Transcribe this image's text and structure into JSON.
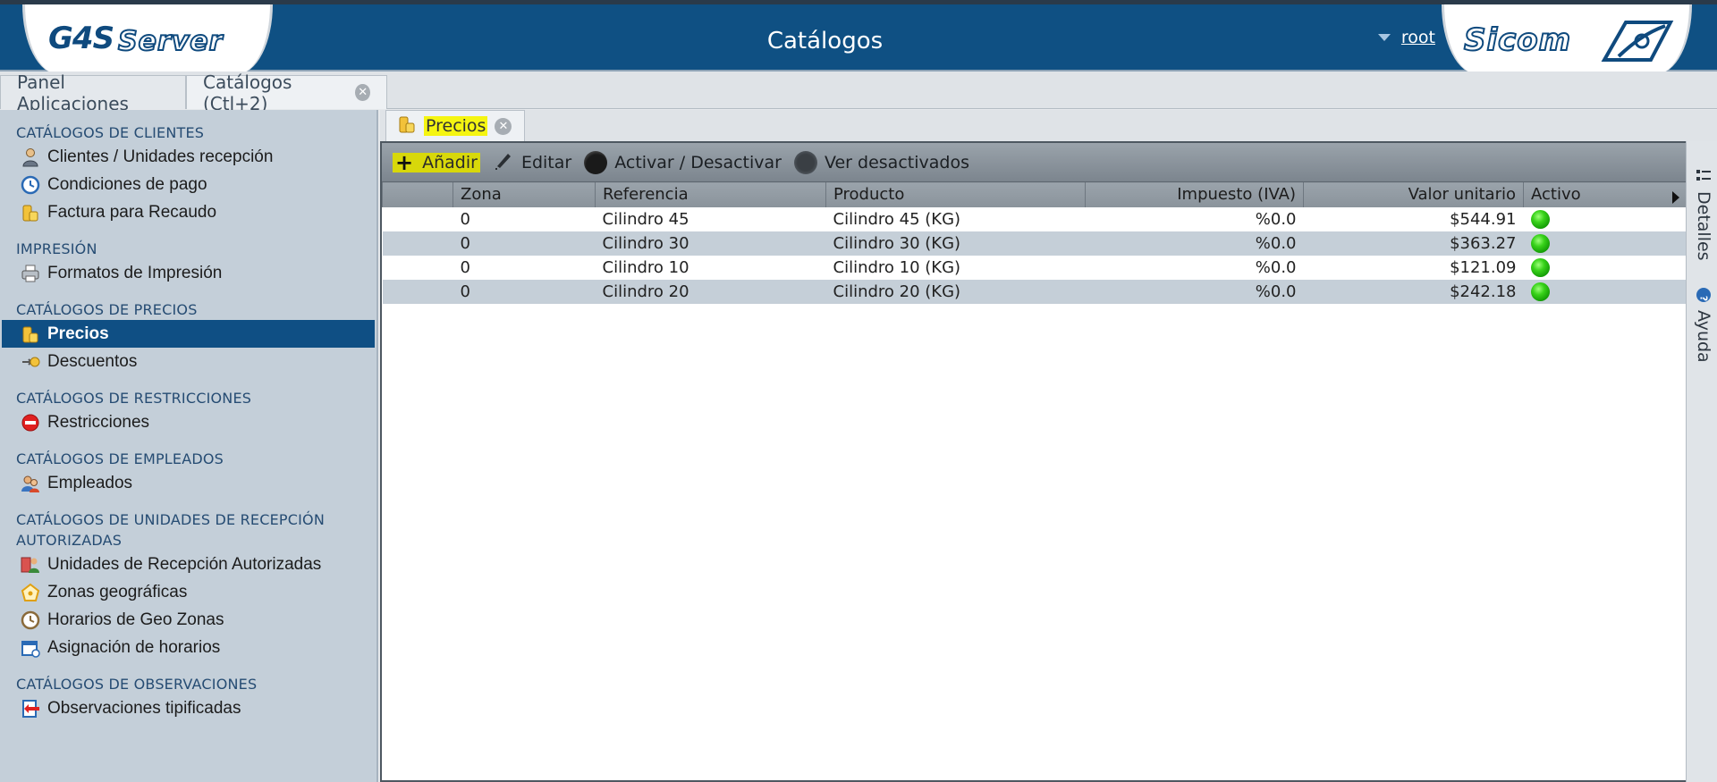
{
  "header": {
    "title": "Catálogos",
    "user": "root",
    "logo_left": {
      "part1": "G4S",
      "part2": "Server"
    },
    "logo_right": "Sicom"
  },
  "main_tabs": [
    {
      "label": "Panel Aplicaciones"
    },
    {
      "label": "Catálogos (Ctl+2)"
    }
  ],
  "sidebar": {
    "sections": [
      {
        "title": "CATÁLOGOS DE CLIENTES",
        "items": [
          "Clientes / Unidades recepción",
          "Condiciones de pago",
          "Factura para Recaudo"
        ]
      },
      {
        "title": "IMPRESIÓN",
        "items": [
          "Formatos de Impresión"
        ]
      },
      {
        "title": "CATÁLOGOS DE PRECIOS",
        "items": [
          "Precios",
          "Descuentos"
        ]
      },
      {
        "title": "CATÁLOGOS DE RESTRICCIONES",
        "items": [
          "Restricciones"
        ]
      },
      {
        "title": "CATÁLOGOS DE EMPLEADOS",
        "items": [
          "Empleados"
        ]
      },
      {
        "title_line1": "CATÁLOGOS DE UNIDADES DE RECEPCIÓN",
        "title_line2": "AUTORIZADAS",
        "items": [
          "Unidades de Recepción Autorizadas",
          "Zonas geográficas",
          "Horarios de Geo Zonas",
          "Asignación de horarios"
        ]
      },
      {
        "title": "CATÁLOGOS DE OBSERVACIONES",
        "items": [
          "Observaciones tipificadas"
        ]
      }
    ]
  },
  "subtab": {
    "label": "Precios"
  },
  "toolbar": {
    "add": "Añadir",
    "edit": "Editar",
    "toggle": "Activar / Desactivar",
    "show_disabled": "Ver desactivados"
  },
  "grid": {
    "columns": [
      "",
      "Zona",
      "Referencia",
      "Producto",
      "Impuesto (IVA)",
      "Valor unitario",
      "Activo"
    ],
    "rows": [
      {
        "zona": "0",
        "referencia": "Cilindro 45",
        "producto": "Cilindro 45 (KG)",
        "impuesto": "%0.0",
        "valor": "$544.91",
        "activo": true
      },
      {
        "zona": "0",
        "referencia": "Cilindro 30",
        "producto": "Cilindro 30 (KG)",
        "impuesto": "%0.0",
        "valor": "$363.27",
        "activo": true
      },
      {
        "zona": "0",
        "referencia": "Cilindro 10",
        "producto": "Cilindro 10 (KG)",
        "impuesto": "%0.0",
        "valor": "$121.09",
        "activo": true
      },
      {
        "zona": "0",
        "referencia": "Cilindro 20",
        "producto": "Cilindro 20 (KG)",
        "impuesto": "%0.0",
        "valor": "$242.18",
        "activo": true
      }
    ]
  },
  "rightbar": {
    "details": "Detalles",
    "help": "Ayuda"
  },
  "colors": {
    "header_bg": "#0f5083",
    "selected_bg": "#0f4f84",
    "highlight": "#f5f511",
    "active_green": "#38d21a"
  }
}
